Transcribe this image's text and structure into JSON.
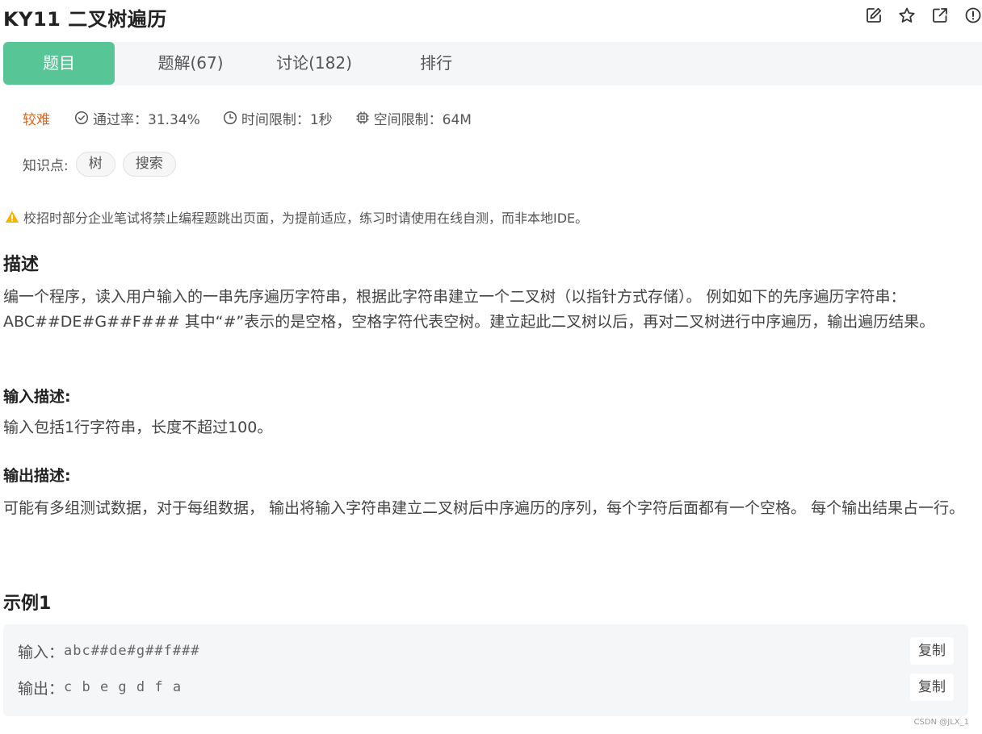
{
  "header": {
    "title": "KY11  二叉树遍历",
    "icons": [
      "edit-icon",
      "star-icon",
      "share-icon",
      "report-icon"
    ]
  },
  "tabs": [
    {
      "label": "题目",
      "active": true
    },
    {
      "label": "题解(67)",
      "active": false
    },
    {
      "label": "讨论(182)",
      "active": false
    },
    {
      "label": "排行",
      "active": false
    }
  ],
  "meta": {
    "difficulty": "较难",
    "pass_rate": "通过率：31.34%",
    "time_limit": "时间限制：1秒",
    "memory_limit": "空间限制：64M"
  },
  "knowledge": {
    "label": "知识点:",
    "tags": [
      "树",
      "搜索"
    ]
  },
  "notice": "校招时部分企业笔试将禁止编程题跳出页面，为提前适应，练习时请使用在线自测，而非本地IDE。",
  "description": {
    "heading": "描述",
    "text": "编一个程序，读入用户输入的一串先序遍历字符串，根据此字符串建立一个二叉树（以指针方式存储）。 例如如下的先序遍历字符串： ABC##DE#G##F### 其中“#”表示的是空格，空格字符代表空树。建立起此二叉树以后，再对二叉树进行中序遍历，输出遍历结果。"
  },
  "input_desc": {
    "heading": "输入描述:",
    "text": "输入包括1行字符串，长度不超过100。"
  },
  "output_desc": {
    "heading": "输出描述:",
    "text": "可能有多组测试数据，对于每组数据， 输出将输入字符串建立二叉树后中序遍历的序列，每个字符后面都有一个空格。 每个输出结果占一行。"
  },
  "example": {
    "heading": "示例1",
    "input_label": "输入：",
    "input_value": "abc##de#g##f###",
    "output_label": "输出：",
    "output_value": "c b e g d f a",
    "copy_label": "复制"
  },
  "watermark": "CSDN @JLX_1",
  "colors": {
    "accent": "#57c595",
    "difficulty": "#d9661f",
    "warning": "#f5b400"
  }
}
